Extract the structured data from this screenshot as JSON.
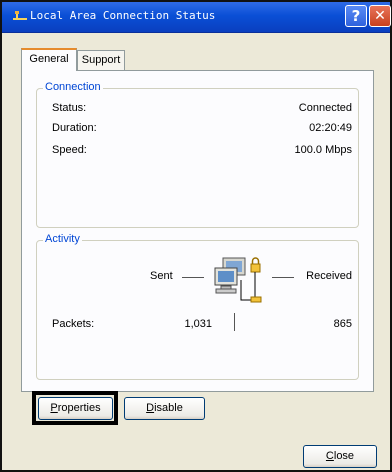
{
  "window": {
    "title": "Local Area Connection Status",
    "help_label": "?",
    "close_label": "✕"
  },
  "tabs": [
    {
      "label": "General",
      "active": true
    },
    {
      "label": "Support",
      "active": false
    }
  ],
  "connection": {
    "legend": "Connection",
    "status_label": "Status:",
    "status_value": "Connected",
    "duration_label": "Duration:",
    "duration_value": "02:20:49",
    "speed_label": "Speed:",
    "speed_value": "100.0 Mbps"
  },
  "activity": {
    "legend": "Activity",
    "sent_label": "Sent",
    "received_label": "Received",
    "packets_label": "Packets:",
    "packets_sent": "1,031",
    "packets_received": "865"
  },
  "buttons": {
    "properties_mnemonic": "P",
    "properties_rest": "roperties",
    "disable_mnemonic": "D",
    "disable_rest": "isable",
    "close_mnemonic": "C",
    "close_rest": "lose"
  },
  "icons": {
    "title_icon": "network-connection-icon",
    "activity_icon": "network-computers-icon"
  }
}
